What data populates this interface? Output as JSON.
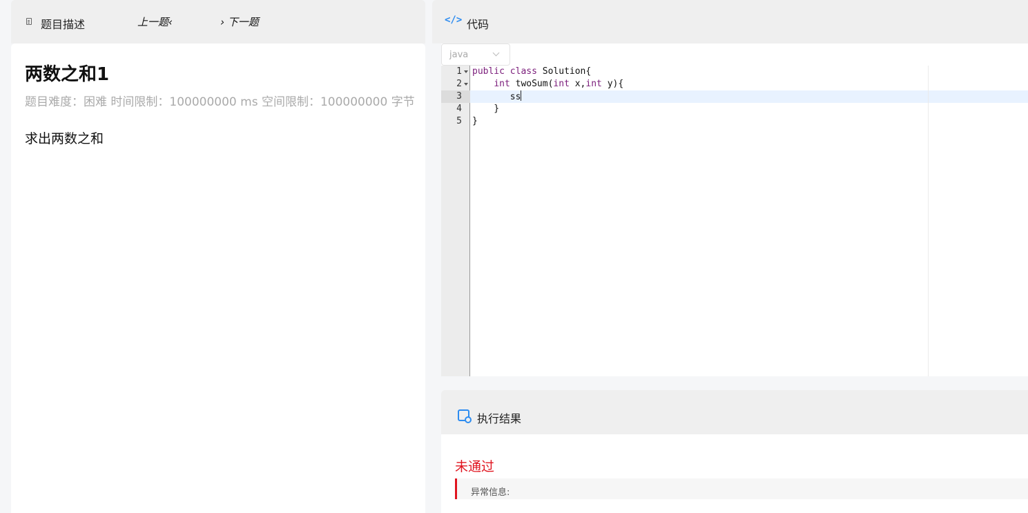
{
  "left_panel": {
    "tab_title": "题目描述",
    "prev_label": "上一题‹",
    "next_label": "› 下一题"
  },
  "problem": {
    "title": "两数之和1",
    "meta": "题目难度：困难 时间限制：100000000 ms 空间限制：100000000 字节",
    "description": "求出两数之和"
  },
  "code_panel": {
    "title": "代码",
    "icon": "code-icon",
    "language": "java",
    "line_numbers": [
      "1",
      "2",
      "3",
      "4",
      "5"
    ],
    "lines": {
      "l1_kw1": "public",
      "l1_kw2": "class",
      "l1_rest": " Solution{",
      "l2_indent": "    ",
      "l2_kw1": "int",
      "l2_mid": " twoSum(",
      "l2_kw2": "int",
      "l2_mid2": " x,",
      "l2_kw3": "int",
      "l2_rest": " y){",
      "l3": "       ss",
      "l4": "    }",
      "l5": "}"
    }
  },
  "result_panel": {
    "title": "执行结果",
    "icon": "result-search-icon",
    "status": "未通过",
    "info_label": "异常信息:"
  },
  "colors": {
    "accent": "#2d8cf0",
    "error": "#e0141f",
    "keyword": "#7a1c7a"
  }
}
